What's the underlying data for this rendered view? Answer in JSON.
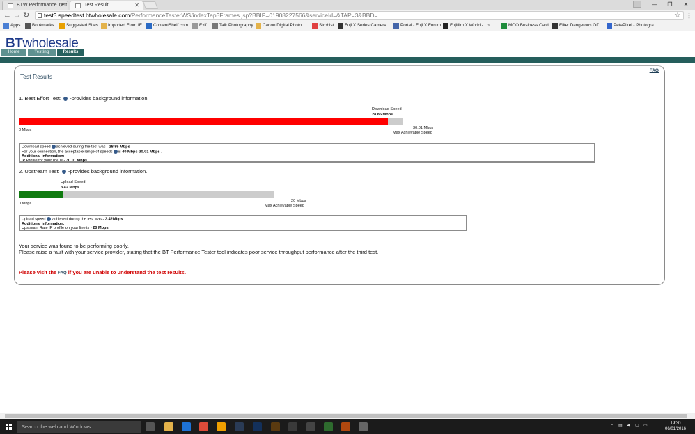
{
  "browser": {
    "tabs": [
      {
        "label": "BTW Performance Test",
        "active": false
      },
      {
        "label": "Test Result",
        "active": true
      }
    ],
    "url_host": "test3.speedtest.btwholesale.com",
    "url_path": "/PerformanceTesterWS/indexTap3Frames.jsp?BBIP=01908227566&serviceId=&TAP=3&BBD=",
    "bookmarks": [
      {
        "label": "Apps",
        "icon": "apps-grid-icon",
        "color": "#4a7fd4"
      },
      {
        "label": "Bookmarks",
        "icon": "star-icon",
        "color": "#555555"
      },
      {
        "label": "Suggested Sites",
        "icon": "ie-sites-icon",
        "color": "#e8a000"
      },
      {
        "label": "Imported From IE",
        "icon": "folder-icon",
        "color": "#e3b24a"
      },
      {
        "label": "ContentShelf.com",
        "icon": "contentshelf-icon",
        "color": "#2a6ac4"
      },
      {
        "label": "Exif",
        "icon": "page-icon",
        "color": "#999999"
      },
      {
        "label": "Talk Photography",
        "icon": "globe-icon",
        "color": "#777777"
      },
      {
        "label": "Canon Digital Photo...",
        "icon": "folder-icon",
        "color": "#e3b24a"
      },
      {
        "label": "Strobist",
        "icon": "strobist-icon",
        "color": "#e04040"
      },
      {
        "label": "Fuji X Series Camera...",
        "icon": "fuji-icon",
        "color": "#333333"
      },
      {
        "label": "Portal - Fuji X Forum",
        "icon": "forum-icon",
        "color": "#4466aa"
      },
      {
        "label": "Fujifilm X World - Lo...",
        "icon": "fujifilm-icon",
        "color": "#222222"
      },
      {
        "label": "MOO Business Card...",
        "icon": "moo-icon",
        "color": "#1f8c3c"
      },
      {
        "label": "Elite: Dangerous Off...",
        "icon": "elite-icon",
        "color": "#333333"
      },
      {
        "label": "PetaPixel - Photogra...",
        "icon": "petapixel-icon",
        "color": "#3366cc"
      }
    ]
  },
  "bt": {
    "logo_bt": "BT",
    "logo_rest": "wholesale",
    "nav_tabs": [
      {
        "label": "Home",
        "active": false
      },
      {
        "label": "Testing",
        "active": false
      },
      {
        "label": "Results",
        "active": true
      }
    ],
    "brand_color": "#255e5c"
  },
  "results": {
    "title": "Test Results",
    "faq": "FAQ",
    "best_effort": {
      "heading": "1. Best Effort Test:",
      "heading_suffix": "-provides background information.",
      "speed_label": "Download Speed",
      "speed_value": "28.85 Mbps",
      "min_label": "0 Mbps",
      "max_value": "30.01 Mbps",
      "max_label": "Max Achievable Speed",
      "fill_fraction": 0.9613,
      "fill_color": "#ff0000",
      "box": {
        "line1_pre": "Download speed",
        "line1_mid": "achieved during the test was - ",
        "line1_val": "28.85 Mbps",
        "line2_pre": "For your connection, the acceptable range of speeds",
        "line2_mid": "is ",
        "line2_val": "40 Mbps-30.01 Mbps",
        "line2_post": " .",
        "line3": "Additional Information:",
        "line4_pre": "IP Profile for your line is - ",
        "line4_val": "30.01 Mbps"
      }
    },
    "upstream": {
      "heading": "2. Upstream Test:",
      "heading_suffix": "-provides background information.",
      "speed_label": "Upload Speed",
      "speed_value": "3.42 Mbps",
      "min_label": "0 Mbps",
      "max_value": "20 Mbps",
      "max_label": "Max Achievable Speed",
      "fill_fraction": 0.171,
      "fill_color": "#0f7a0f",
      "box": {
        "line1_pre": "Upload speed",
        "line1_mid": " achieved during the test was - ",
        "line1_val": "3.42Mbps",
        "line2": "Additional Information:",
        "line3_pre": "Upstream Rate IP profile on your line is - ",
        "line3_val": "20 Mbps"
      }
    },
    "message_line1": "Your service was found to be performing poorly.",
    "message_line2": "Please raise a fault with your service provider, stating that the BT Performance Tester tool indicates poor service throughput performance after the third test.",
    "visit_pre": "Please visit the ",
    "visit_link": "FAQ",
    "visit_post": " if you are unable to understand the test results."
  },
  "taskbar": {
    "search_placeholder": "Search the web and Windows",
    "time": "19:30",
    "date": "06/01/2016",
    "apps": [
      {
        "name": "task-view-icon",
        "color": "#555555"
      },
      {
        "name": "file-explorer-icon",
        "color": "#e3b24a"
      },
      {
        "name": "edge-icon",
        "color": "#1e73d6"
      },
      {
        "name": "chrome-icon",
        "color": "#dd4b39"
      },
      {
        "name": "outlook-icon",
        "color": "#f0a000"
      },
      {
        "name": "lightroom-icon",
        "color": "#2a3b55"
      },
      {
        "name": "photoshop-icon",
        "color": "#13305a"
      },
      {
        "name": "bridge-icon",
        "color": "#5a3a10"
      },
      {
        "name": "app-icon",
        "color": "#3a3a3a"
      },
      {
        "name": "camera-app-icon",
        "color": "#444444"
      },
      {
        "name": "cortana-app-icon",
        "color": "#2e6b2e"
      },
      {
        "name": "firefox-icon",
        "color": "#b0480f"
      },
      {
        "name": "settings-icon",
        "color": "#666666"
      }
    ]
  }
}
